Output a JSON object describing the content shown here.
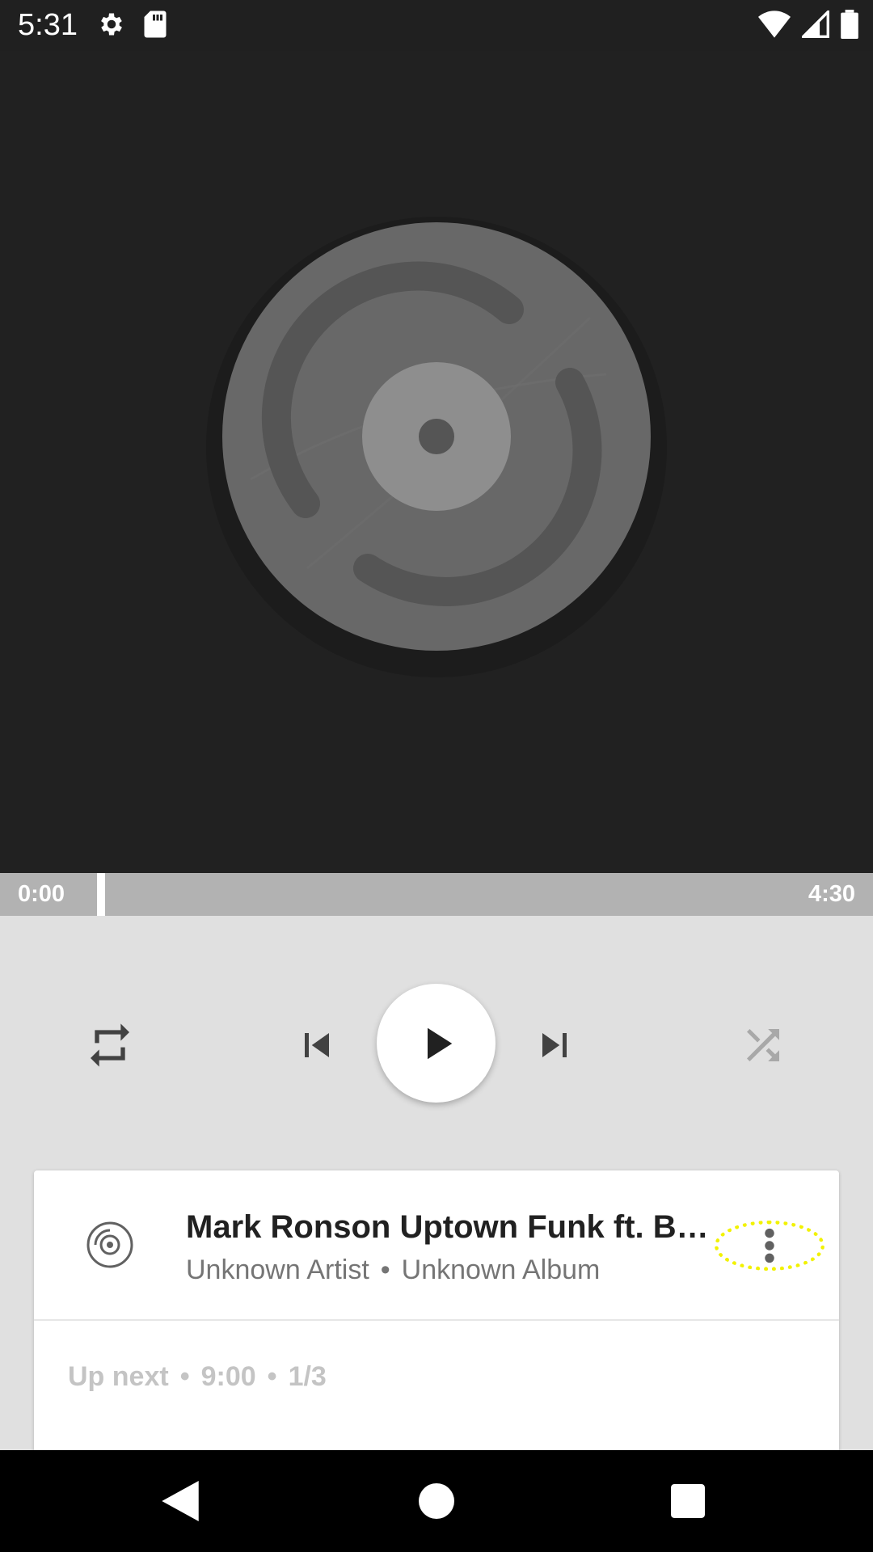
{
  "status_bar": {
    "time": "5:31",
    "left_icons": [
      "settings-icon",
      "sd-card-icon"
    ],
    "right_icons": [
      "wifi-icon",
      "cell-signal-icon",
      "battery-icon"
    ]
  },
  "player": {
    "artwork": "vinyl-record-placeholder",
    "progress": {
      "current_time": "0:00",
      "total_time": "4:30",
      "fraction": 0.0
    },
    "controls": {
      "repeat_icon": "repeat-icon",
      "previous_icon": "skip-previous-icon",
      "play_icon": "play-icon",
      "next_icon": "skip-next-icon",
      "shuffle_icon": "shuffle-icon"
    }
  },
  "now_playing": {
    "title": "Mark Ronson  Uptown Funk ft. B…",
    "artist": "Unknown Artist",
    "separator": "•",
    "album": "Unknown Album",
    "menu_icon": "more-vert-icon"
  },
  "up_next": {
    "label": "Up next",
    "separator": "•",
    "duration": "9:00",
    "position": "1/3"
  },
  "nav_bar": {
    "buttons": [
      "back-icon",
      "home-icon",
      "recents-icon"
    ]
  },
  "colors": {
    "art_background": "#212121",
    "controls_background": "#e0e0e0",
    "progress_track": "#b2b2b2",
    "highlight": "#f2f200"
  }
}
